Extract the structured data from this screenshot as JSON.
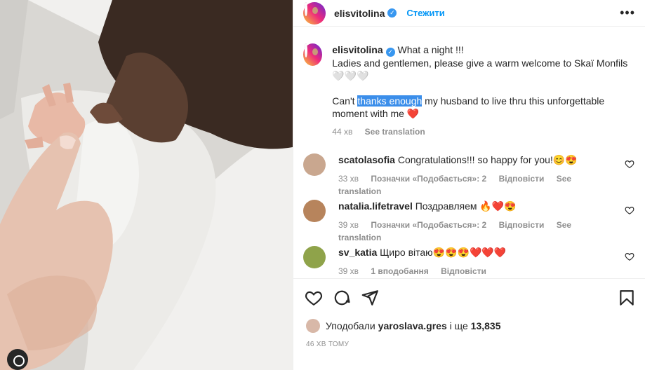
{
  "post": {
    "username": "elisvitolina",
    "follow_label": "Стежити",
    "more_label": "•••"
  },
  "caption": {
    "line1": "What a night !!!",
    "line2": "Ladies and gentlemen, please give a warm welcome to Skaï Monfils 🤍🤍🤍",
    "line3_before": "Can't ",
    "line3_highlight": "thanks enough",
    "line3_after": " my husband to live thru this unforgettable moment with me",
    "time": "44 хв",
    "see_translation": "See translation"
  },
  "comments": [
    {
      "username": "scatolasofia",
      "text": "Congratulations!!! so happy for you!😊😍",
      "time": "33 хв",
      "likes": "Позначки «Подобається»: 2",
      "reply": "Відповісти",
      "translate": "See translation"
    },
    {
      "username": "natalia.lifetravel",
      "text": "Поздравляем 🔥❤️😍",
      "time": "39 хв",
      "likes": "Позначки «Подобається»: 2",
      "reply": "Відповісти",
      "translate": "See translation"
    },
    {
      "username": "sv_katia",
      "text": "Щиро вітаю😍😍😍❤️❤️❤️",
      "time": "39 хв",
      "likes": "1 вподобання",
      "reply": "Відповісти"
    }
  ],
  "likes": {
    "prefix": "Уподобали",
    "user": "yaroslava.gres",
    "middle": "і ще",
    "count": "13,835"
  },
  "posted_ago": "46 ХВ ТОМУ",
  "colors": {
    "accent": "#0095f6",
    "verified": "#3897f0",
    "muted": "#8e8e8e",
    "highlight": "#3b8eea",
    "heart": "#ed4956"
  }
}
